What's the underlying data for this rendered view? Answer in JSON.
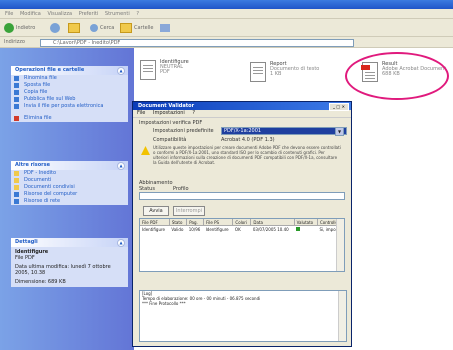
{
  "window": {
    "menu": [
      "File",
      "Modifica",
      "Visualizza",
      "Preferiti",
      "Strumenti",
      "?"
    ],
    "toolbar": {
      "back_label": "Indietro",
      "search_label": "Cerca",
      "folders_label": "Cartelle"
    },
    "address": {
      "label": "Indirizzo",
      "path": "C:\\Lavori\\PDF - Inedito\\PDF"
    }
  },
  "sidebar": {
    "tasks_panel": {
      "title": "Operazioni file e cartelle",
      "items": [
        "Rinomina file",
        "Sposta file",
        "Copia file",
        "Pubblica file sul Web",
        "Invia il file per posta elettronica",
        "Elimina file"
      ]
    },
    "places_panel": {
      "title": "Altre risorse",
      "items": [
        "PDF - Inedito",
        "Documenti",
        "Documenti condivisi",
        "Risorse del computer",
        "Risorse di rete"
      ]
    },
    "details_panel": {
      "title": "Dettagli",
      "name": "Identifigure",
      "type": "File PDF",
      "modified": "Data ultima modifica: lunedì 7 ottobre 2005, 10.38",
      "size": "Dimensione: 689 KB"
    }
  },
  "files": [
    {
      "name": "Identifigure",
      "type": "NEUTRAL",
      "size": "PDF"
    },
    {
      "name": "Report",
      "type": "Documento di testo",
      "size": "1 KB"
    },
    {
      "name": "Result",
      "type": "Adobe Acrobat Document",
      "size": "688 KB"
    }
  ],
  "dialog": {
    "title": "Document Validator",
    "menu": [
      "File",
      "Impostazioni",
      "?"
    ],
    "section_label": "Impostazioni verifica PDF",
    "profile_label": "Impostazioni predefinite",
    "profile_value": "PDF/X-1a:2001",
    "compat_label": "Compatibilità",
    "compat_value": "Acrobat 4.0 (PDF 1.3)",
    "description": "Utilizzare queste impostazioni per creare documenti Adobe PDF che devono essere controllati o conformi a PDF/X-1a:2001, uno standard ISO per lo scambio di contenuti grafici. Per ulteriori informazioni sulla creazione di documenti PDF compatibili con PDF/X-1a, consultare la Guida dell'utente di Acrobat.",
    "attachments_label": "Abbinamento",
    "attach_cols": [
      "Status",
      "Profilo"
    ],
    "start_button": "Avvia",
    "stop_button": "Interrompi",
    "list_headers": [
      "File PDF",
      "Stato",
      "Pag.",
      "File PS",
      "Colori",
      "Data",
      "Valutato",
      "Controllo"
    ],
    "list_row": [
      "Identifigure",
      "Valido",
      "10/96",
      "Identifigure",
      "OK",
      "03/07/2005 10.40",
      "",
      "Si, impo..."
    ],
    "log_lines": [
      "[Log]",
      "",
      "",
      "Tempo di elaborazione: 00 ore - 00 minuti - 06.875 secondi",
      "*** Fine Protocollo ***"
    ]
  }
}
